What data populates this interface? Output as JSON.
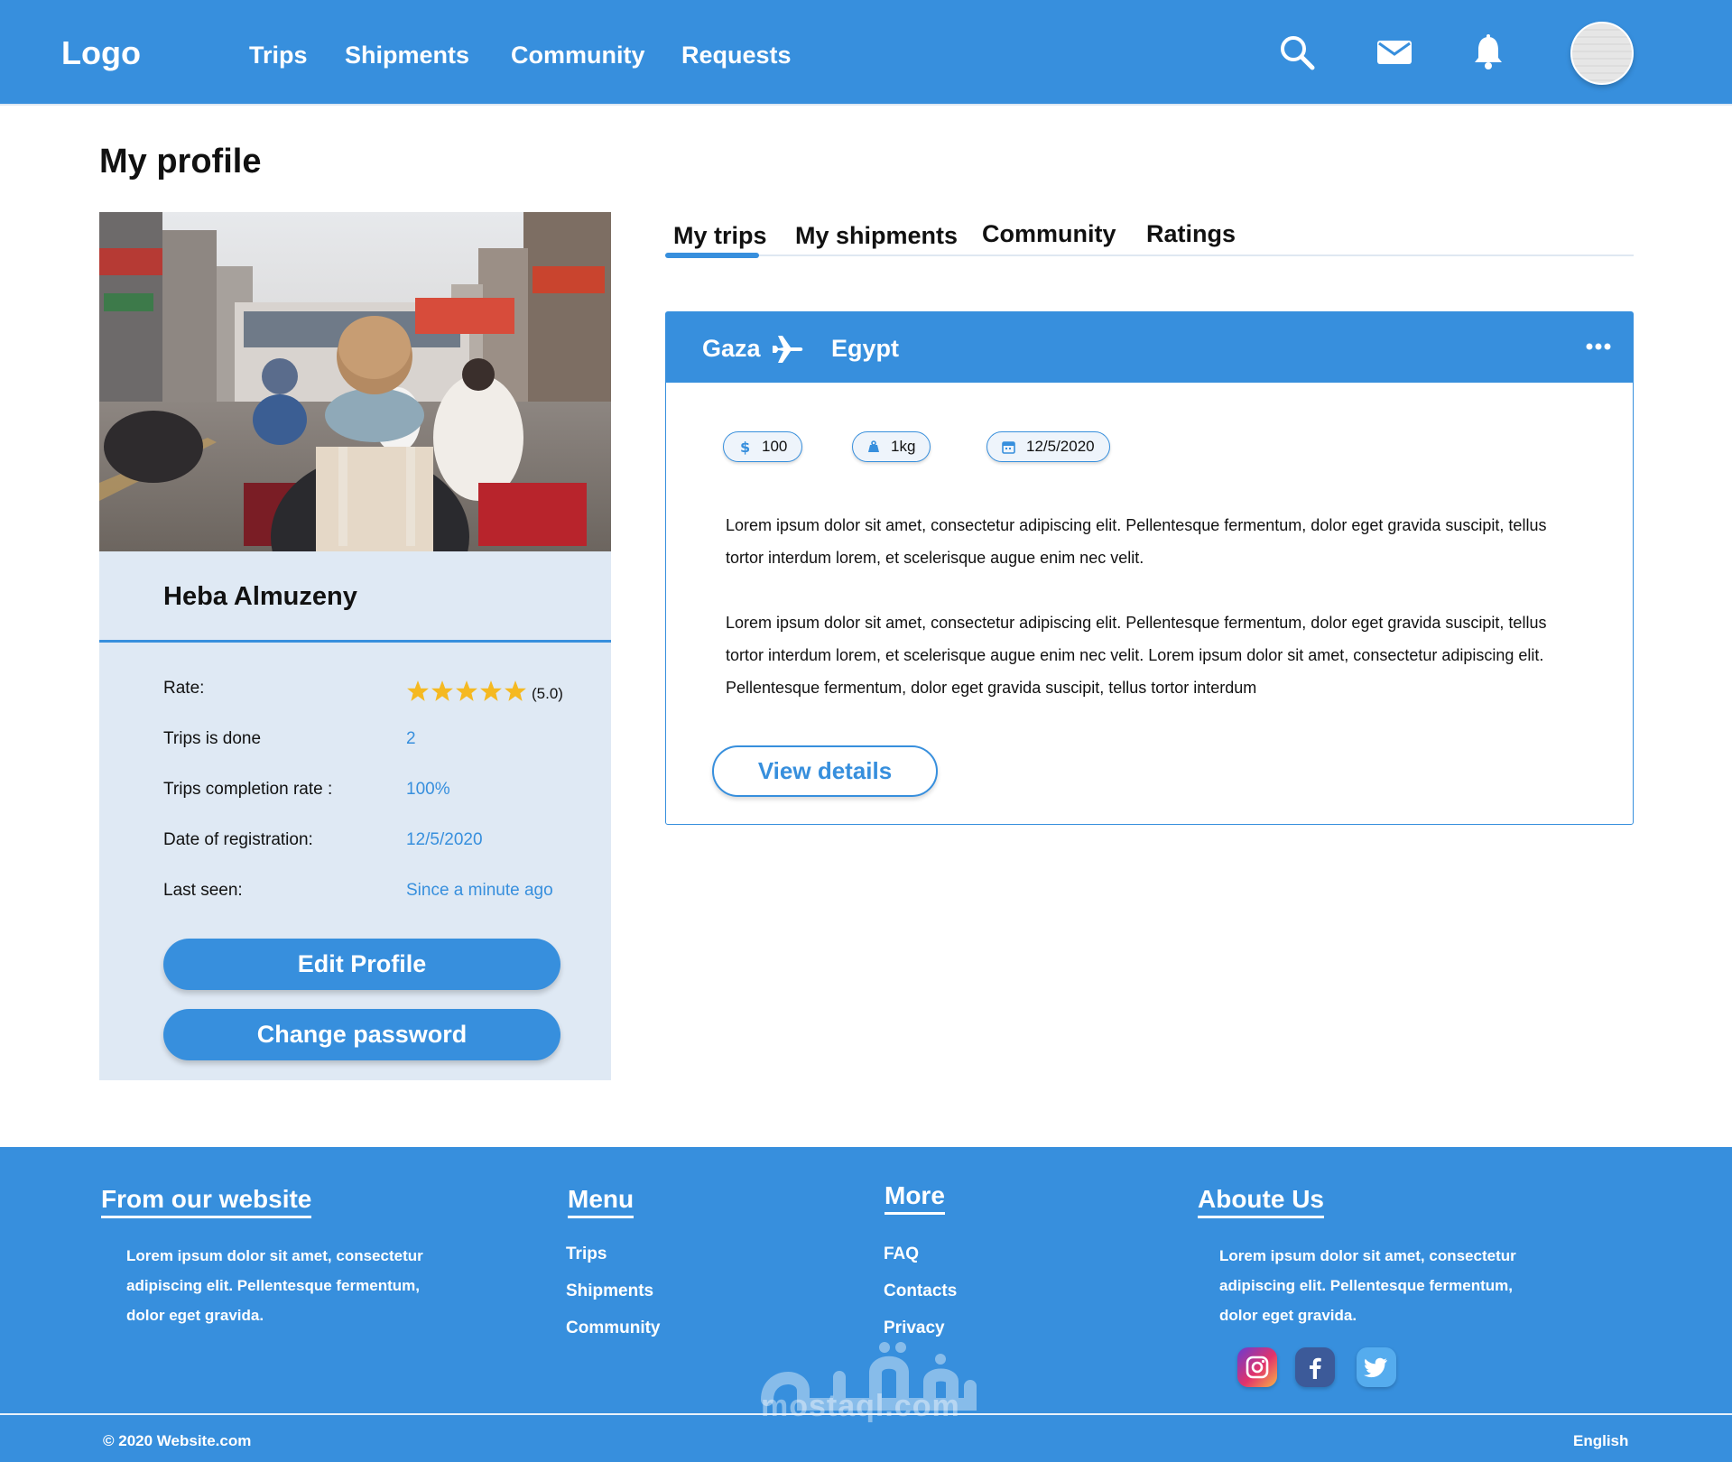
{
  "header": {
    "logo": "Logo",
    "nav": [
      "Trips",
      "Shipments",
      "Community",
      "Requests"
    ]
  },
  "page": {
    "title": "My profile"
  },
  "profile": {
    "name": "Heba Almuzeny",
    "rating": 5.0,
    "rate_label": "Rate:",
    "rate_text": "(5.0)",
    "stats": [
      {
        "label": "Trips is done",
        "value": "2"
      },
      {
        "label": "Trips completion rate :",
        "value": "100%"
      },
      {
        "label": "Date  of registration:",
        "value": "12/5/2020"
      },
      {
        "label": "Last seen:",
        "value": "Since a minute ago"
      }
    ],
    "edit_label": "Edit Profile",
    "password_label": "Change password"
  },
  "tabs": [
    "My trips",
    "My shipments",
    "Community",
    "Ratings"
  ],
  "trip": {
    "from": "Gaza",
    "to": "Egypt",
    "price": "100",
    "weight": "1kg",
    "date": "12/5/2020",
    "paragraph1": "Lorem ipsum dolor sit amet, consectetur adipiscing elit. Pellentesque fermentum, dolor eget gravida suscipit, tellus tortor interdum lorem, et scelerisque augue enim nec velit.",
    "paragraph2": "Lorem ipsum dolor sit amet, consectetur adipiscing elit. Pellentesque fermentum, dolor eget gravida suscipit, tellus tortor interdum lorem, et scelerisque augue enim nec velit. Lorem ipsum dolor sit amet, consectetur adipiscing elit. Pellentesque fermentum, dolor eget gravida suscipit, tellus tortor interdum",
    "details_label": "View details"
  },
  "footer": {
    "col1_title": "From our website",
    "col1_text": "Lorem ipsum dolor sit amet, consectetur adipiscing elit. Pellentesque fermentum, dolor eget gravida.",
    "col2_title": "Menu",
    "col2_links": [
      "Trips",
      "Shipments",
      "Community"
    ],
    "col3_title": "More",
    "col3_links": [
      "FAQ",
      "Contacts",
      "Privacy"
    ],
    "col4_title": "Aboute Us",
    "col4_text": "Lorem ipsum dolor sit amet, consectetur adipiscing elit. Pellentesque fermentum, dolor eget gravida.",
    "copyright": "© 2020 Website.com",
    "language": "English",
    "watermark": "mostaql.com"
  },
  "colors": {
    "primary": "#378fdd",
    "card_bg": "#dfe9f4",
    "star": "#f5b921"
  },
  "icons": [
    "search-icon",
    "mail-icon",
    "bell-icon",
    "airplane-icon",
    "more-icon",
    "dollar-icon",
    "weight-icon",
    "calendar-icon",
    "star-icon",
    "instagram-icon",
    "facebook-icon",
    "twitter-icon"
  ]
}
